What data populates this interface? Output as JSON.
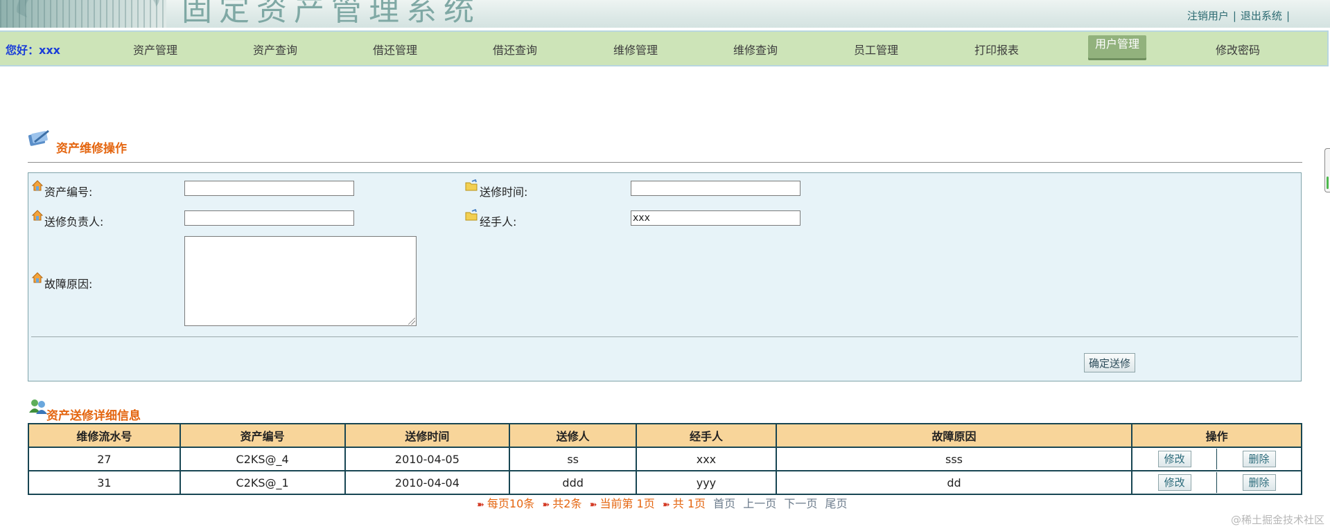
{
  "banner": {
    "title": "固定资产管理系统",
    "links": [
      "注销用户",
      "退出系统"
    ]
  },
  "nav": {
    "greeting": "您好：xxx",
    "items": [
      {
        "label": "资产管理"
      },
      {
        "label": "资产查询"
      },
      {
        "label": "借还管理"
      },
      {
        "label": "借还查询"
      },
      {
        "label": "维修管理"
      },
      {
        "label": "维修查询"
      },
      {
        "label": "员工管理"
      },
      {
        "label": "打印报表"
      },
      {
        "label": "用户管理",
        "active": true
      },
      {
        "label": "修改密码"
      }
    ]
  },
  "repair_form": {
    "title": "资产维修操作",
    "asset_no_label": "资产编号:",
    "asset_no_value": "",
    "send_time_label": "送修时间:",
    "send_time_value": "",
    "responsible_label": "送修负责人:",
    "responsible_value": "",
    "handler_label": "经手人:",
    "handler_value": "xxx",
    "reason_label": "故障原因:",
    "reason_value": "",
    "submit_label": "确定送修"
  },
  "detail": {
    "title": "资产送修详细信息",
    "columns": [
      "维修流水号",
      "资产编号",
      "送修时间",
      "送修人",
      "经手人",
      "故障原因",
      "操作"
    ],
    "rows": [
      {
        "id": "27",
        "asset": "C2KS@_4",
        "date": "2010-04-05",
        "sender": "ss",
        "handler": "xxx",
        "reason": "sss"
      },
      {
        "id": "31",
        "asset": "C2KS@_1",
        "date": "2010-04-04",
        "sender": "ddd",
        "handler": "yyy",
        "reason": "dd"
      }
    ],
    "edit_label": "修改",
    "delete_label": "删除"
  },
  "pager": {
    "per_page": "每页10条",
    "total": "共2条",
    "current": "当前第 1页",
    "pages": "共 1页",
    "first": "首页",
    "prev": "上一页",
    "next": "下一页",
    "last": "尾页"
  },
  "watermark": "@稀土掘金技术社区",
  "colors": {
    "nav_bg": "#cde4b8",
    "nav_active": "#92b27d",
    "greeting": "#1a3dd8",
    "section_title": "#e4650f",
    "panel_bg": "#e7f3f8",
    "table_header": "#f8d59a",
    "table_border": "#174552"
  }
}
